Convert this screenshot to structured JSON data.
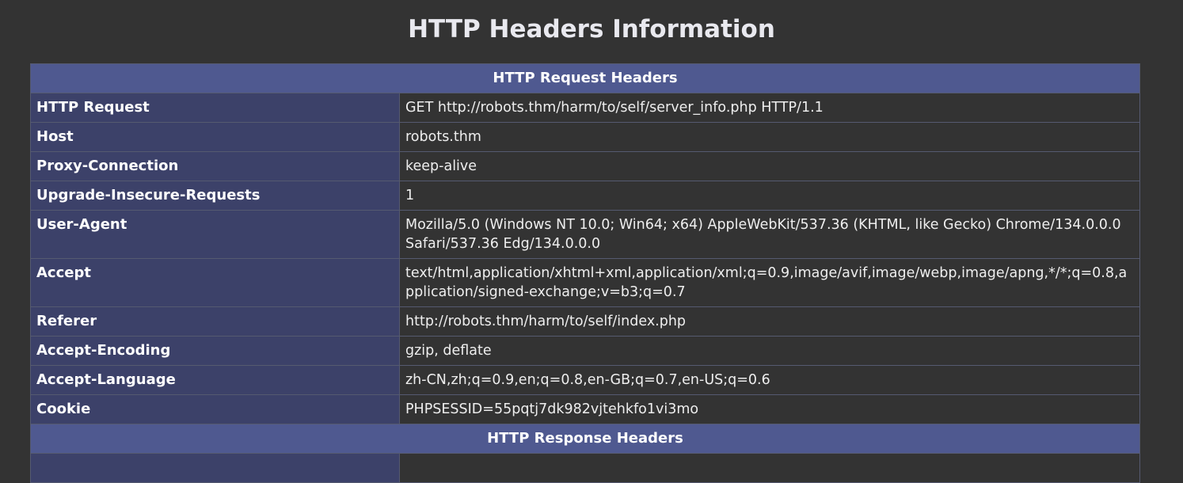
{
  "page": {
    "title": "HTTP Headers Information"
  },
  "request": {
    "section_title": "HTTP Request Headers",
    "rows": [
      {
        "name": "HTTP Request",
        "value": "GET http://robots.thm/harm/to/self/server_info.php HTTP/1.1"
      },
      {
        "name": "Host",
        "value": "robots.thm"
      },
      {
        "name": "Proxy-Connection",
        "value": "keep-alive"
      },
      {
        "name": "Upgrade-Insecure-Requests",
        "value": "1"
      },
      {
        "name": "User-Agent",
        "value": "Mozilla/5.0 (Windows NT 10.0; Win64; x64) AppleWebKit/537.36 (KHTML, like Gecko) Chrome/134.0.0.0 Safari/537.36 Edg/134.0.0.0"
      },
      {
        "name": "Accept",
        "value": "text/html,application/xhtml+xml,application/xml;q=0.9,image/avif,image/webp,image/apng,*/*;q=0.8,application/signed-exchange;v=b3;q=0.7"
      },
      {
        "name": "Referer",
        "value": "http://robots.thm/harm/to/self/index.php"
      },
      {
        "name": "Accept-Encoding",
        "value": "gzip, deflate"
      },
      {
        "name": "Accept-Language",
        "value": "zh-CN,zh;q=0.9,en;q=0.8,en-GB;q=0.7,en-US;q=0.6"
      },
      {
        "name": "Cookie",
        "value": "PHPSESSID=55pqtj7dk982vjtehkfo1vi3mo"
      }
    ]
  },
  "response": {
    "section_title": "HTTP Response Headers"
  },
  "colors": {
    "background": "#333333",
    "section_header": "#4f5990",
    "name_cell": "#3c4169"
  }
}
